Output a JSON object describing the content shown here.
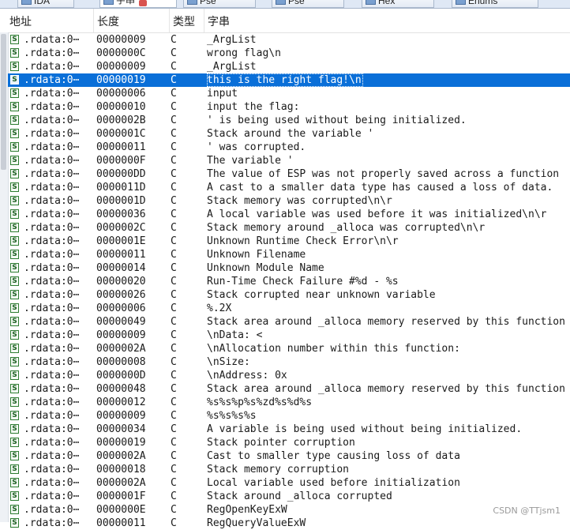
{
  "tabs": [
    {
      "label": "IDA",
      "active": false
    },
    {
      "label": "字串",
      "active": true
    },
    {
      "label": "Pse",
      "active": false
    },
    {
      "label": "Pse",
      "active": false
    },
    {
      "label": "Hex",
      "active": false
    },
    {
      "label": "Enums",
      "active": false
    }
  ],
  "columns": {
    "address": "地址",
    "length": "长度",
    "type": "类型",
    "string": "字串"
  },
  "selected_index": 3,
  "rows": [
    {
      "address": ".rdata:0⋯",
      "length": "00000009",
      "type": "C",
      "string": "_ArgList"
    },
    {
      "address": ".rdata:0⋯",
      "length": "0000000C",
      "type": "C",
      "string": "wrong flag\\n"
    },
    {
      "address": ".rdata:0⋯",
      "length": "00000009",
      "type": "C",
      "string": "_ArgList"
    },
    {
      "address": ".rdata:0⋯",
      "length": "00000019",
      "type": "C",
      "string": "this is the right flag!\\n"
    },
    {
      "address": ".rdata:0⋯",
      "length": "00000006",
      "type": "C",
      "string": "input"
    },
    {
      "address": ".rdata:0⋯",
      "length": "00000010",
      "type": "C",
      "string": "input the flag:"
    },
    {
      "address": ".rdata:0⋯",
      "length": "0000002B",
      "type": "C",
      "string": "' is being used without being initialized."
    },
    {
      "address": ".rdata:0⋯",
      "length": "0000001C",
      "type": "C",
      "string": "Stack around the variable '"
    },
    {
      "address": ".rdata:0⋯",
      "length": "00000011",
      "type": "C",
      "string": "' was corrupted."
    },
    {
      "address": ".rdata:0⋯",
      "length": "0000000F",
      "type": "C",
      "string": "The variable '"
    },
    {
      "address": ".rdata:0⋯",
      "length": "000000DD",
      "type": "C",
      "string": "The value of ESP was not properly saved across a function"
    },
    {
      "address": ".rdata:0⋯",
      "length": "0000011D",
      "type": "C",
      "string": "A cast to a smaller data type has caused a loss of data."
    },
    {
      "address": ".rdata:0⋯",
      "length": "0000001D",
      "type": "C",
      "string": "Stack memory was corrupted\\n\\r"
    },
    {
      "address": ".rdata:0⋯",
      "length": "00000036",
      "type": "C",
      "string": "A local variable was used before it was initialized\\n\\r"
    },
    {
      "address": ".rdata:0⋯",
      "length": "0000002C",
      "type": "C",
      "string": "Stack memory around _alloca was corrupted\\n\\r"
    },
    {
      "address": ".rdata:0⋯",
      "length": "0000001E",
      "type": "C",
      "string": "Unknown Runtime Check Error\\n\\r"
    },
    {
      "address": ".rdata:0⋯",
      "length": "00000011",
      "type": "C",
      "string": "Unknown Filename"
    },
    {
      "address": ".rdata:0⋯",
      "length": "00000014",
      "type": "C",
      "string": "Unknown Module Name"
    },
    {
      "address": ".rdata:0⋯",
      "length": "00000020",
      "type": "C",
      "string": "Run-Time Check Failure #%d - %s"
    },
    {
      "address": ".rdata:0⋯",
      "length": "00000026",
      "type": "C",
      "string": "Stack corrupted near unknown variable"
    },
    {
      "address": ".rdata:0⋯",
      "length": "00000006",
      "type": "C",
      "string": "%.2X"
    },
    {
      "address": ".rdata:0⋯",
      "length": "00000049",
      "type": "C",
      "string": "Stack area around _alloca memory reserved by this function"
    },
    {
      "address": ".rdata:0⋯",
      "length": "00000009",
      "type": "C",
      "string": "\\nData: <"
    },
    {
      "address": ".rdata:0⋯",
      "length": "0000002A",
      "type": "C",
      "string": "\\nAllocation number within this function:"
    },
    {
      "address": ".rdata:0⋯",
      "length": "00000008",
      "type": "C",
      "string": "\\nSize:"
    },
    {
      "address": ".rdata:0⋯",
      "length": "0000000D",
      "type": "C",
      "string": "\\nAddress: 0x"
    },
    {
      "address": ".rdata:0⋯",
      "length": "00000048",
      "type": "C",
      "string": "Stack area around _alloca memory reserved by this function"
    },
    {
      "address": ".rdata:0⋯",
      "length": "00000012",
      "type": "C",
      "string": "%s%s%p%s%zd%s%d%s"
    },
    {
      "address": ".rdata:0⋯",
      "length": "00000009",
      "type": "C",
      "string": "%s%s%s%s"
    },
    {
      "address": ".rdata:0⋯",
      "length": "00000034",
      "type": "C",
      "string": "A variable is being used without being initialized."
    },
    {
      "address": ".rdata:0⋯",
      "length": "00000019",
      "type": "C",
      "string": "Stack pointer corruption"
    },
    {
      "address": ".rdata:0⋯",
      "length": "0000002A",
      "type": "C",
      "string": "Cast to smaller type causing loss of data"
    },
    {
      "address": ".rdata:0⋯",
      "length": "00000018",
      "type": "C",
      "string": "Stack memory corruption"
    },
    {
      "address": ".rdata:0⋯",
      "length": "0000002A",
      "type": "C",
      "string": "Local variable used before initialization"
    },
    {
      "address": ".rdata:0⋯",
      "length": "0000001F",
      "type": "C",
      "string": "Stack around _alloca corrupted"
    },
    {
      "address": ".rdata:0⋯",
      "length": "0000000E",
      "type": "C",
      "string": "RegOpenKeyExW"
    },
    {
      "address": ".rdata:0⋯",
      "length": "00000011",
      "type": "C",
      "string": "RegQueryValueExW"
    }
  ],
  "row_icon_glyph": "S",
  "icons": {
    "row": "string-item-icon",
    "tab_close": "close-icon",
    "tab": "view-icon"
  },
  "colors": {
    "selection": "#0a6fd8",
    "row_icon": "#2e7d32"
  },
  "watermark": "CSDN @TTjsm1"
}
